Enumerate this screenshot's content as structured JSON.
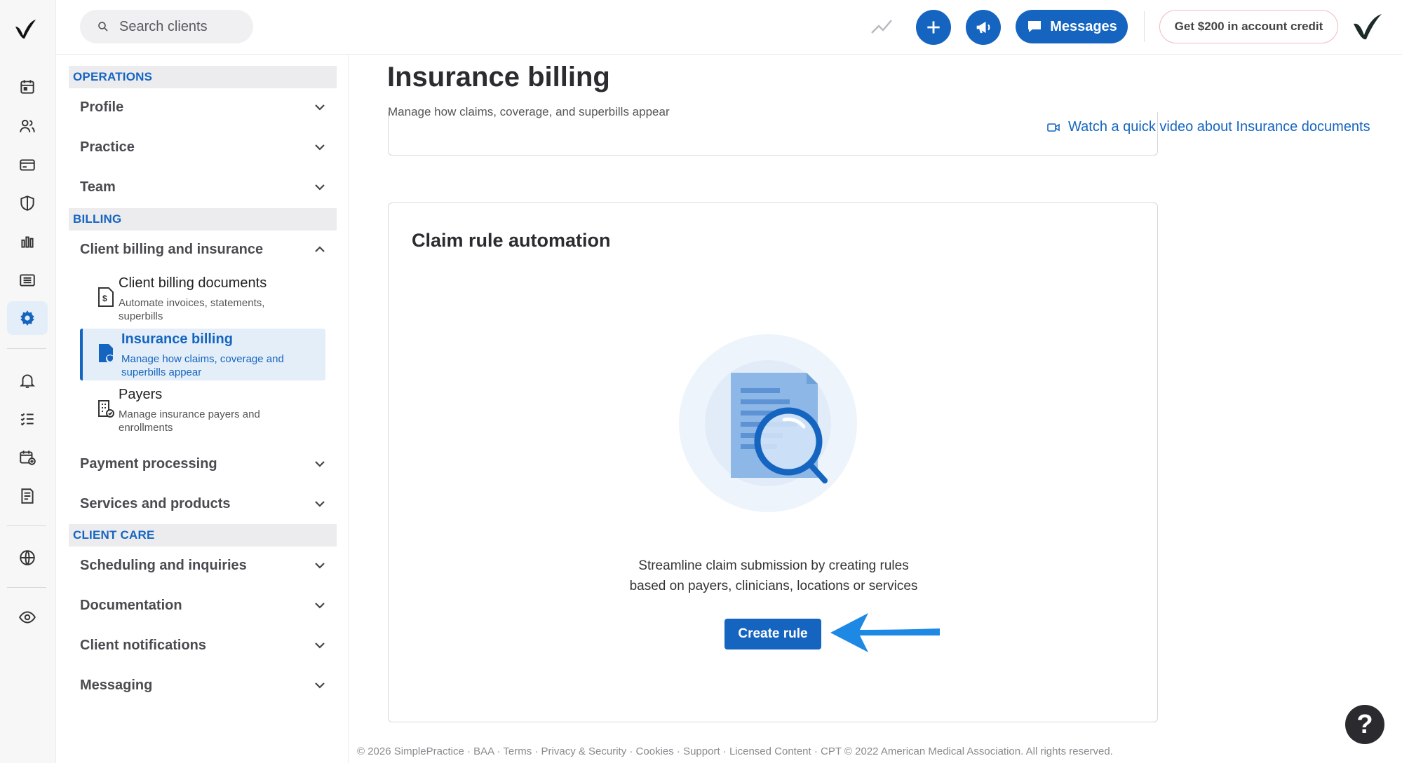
{
  "topbar": {
    "search_placeholder": "Search clients",
    "messages_label": "Messages",
    "credit_label": "Get $200 in account credit"
  },
  "rail": {
    "items": [
      "calendar-icon",
      "clients-icon",
      "billing-card-icon",
      "insurance-shield-icon",
      "analytics-icon",
      "activity-list-icon",
      "settings-icon",
      "notifications-icon",
      "tasks-icon",
      "requests-icon",
      "documents-icon",
      "website-icon",
      "privacy-eye-icon"
    ],
    "active": "settings-icon"
  },
  "nav": {
    "sections": {
      "operations": "OPERATIONS",
      "billing": "BILLING",
      "client_care": "CLIENT CARE"
    },
    "items": {
      "profile": "Profile",
      "practice": "Practice",
      "team": "Team",
      "client_billing_insurance": "Client billing and insurance",
      "payment_processing": "Payment processing",
      "services_products": "Services and products",
      "scheduling": "Scheduling and inquiries",
      "documentation": "Documentation",
      "client_notifications": "Client notifications",
      "messaging": "Messaging"
    },
    "subitems": [
      {
        "title": "Client billing documents",
        "desc": "Automate invoices, statements, superbills"
      },
      {
        "title": "Insurance billing",
        "desc": "Manage how claims, coverage and superbills appear"
      },
      {
        "title": "Payers",
        "desc": "Manage insurance payers and enrollments"
      }
    ]
  },
  "main": {
    "title": "Insurance billing",
    "subtitle": "Manage how claims, coverage, and superbills appear",
    "video_link": "Watch a quick video about Insurance documents",
    "card": {
      "heading": "Claim rule automation",
      "message_line1": "Streamline claim submission by creating rules",
      "message_line2": "based on payers, clinicians, locations or services",
      "button": "Create rule"
    }
  },
  "footer": "© 2026 SimplePractice · BAA · Terms · Privacy & Security · Cookies · Support · Licensed Content · CPT © 2022 American Medical Association. All rights reserved.",
  "help_label": "?",
  "colors": {
    "primary": "#1565c0",
    "accent_arrow": "#1e88e5",
    "active_bg": "#e4eef8"
  }
}
